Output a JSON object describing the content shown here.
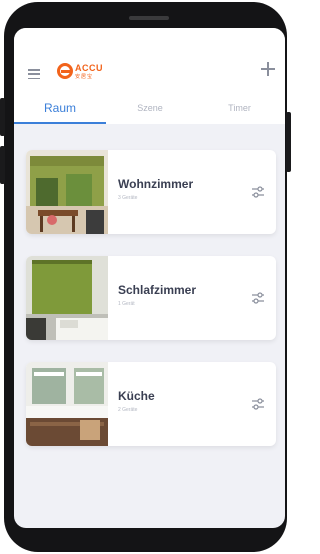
{
  "app": {
    "logo": {
      "brand": "ACCU",
      "sub": "安居宝"
    }
  },
  "tabs": [
    {
      "label": "Raum",
      "active": true
    },
    {
      "label": "Szene",
      "active": false
    },
    {
      "label": "Timer",
      "active": false
    }
  ],
  "rooms": [
    {
      "name": "Wohnzimmer",
      "count": "3 Geräte"
    },
    {
      "name": "Schlafzimmer",
      "count": "1 Gerät"
    },
    {
      "name": "Küche",
      "count": "2 Geräte"
    }
  ],
  "colors": {
    "accent": "#3b7fd9",
    "brand": "#f2631b",
    "background": "#f0f1f6"
  },
  "icons": {
    "menu": "hamburger-menu-icon",
    "add": "plus-icon",
    "room_settings": "sliders-icon"
  }
}
